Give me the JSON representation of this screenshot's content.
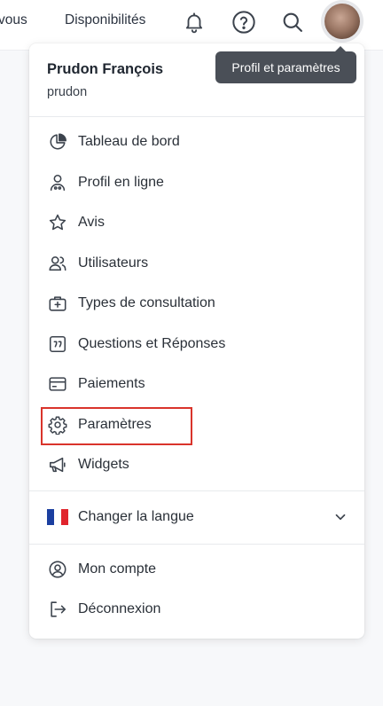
{
  "topbar": {
    "nav_partial": "vous",
    "nav_disponibilites": "Disponibilités"
  },
  "tooltip": {
    "text": "Profil et paramètres"
  },
  "user": {
    "name": "Prudon François",
    "username": "prudon"
  },
  "menu": {
    "items": [
      {
        "label": "Tableau de bord",
        "icon": "pie-chart-icon"
      },
      {
        "label": "Profil en ligne",
        "icon": "profile-icon"
      },
      {
        "label": "Avis",
        "icon": "star-icon"
      },
      {
        "label": "Utilisateurs",
        "icon": "users-icon"
      },
      {
        "label": "Types de consultation",
        "icon": "medical-kit-icon"
      },
      {
        "label": "Questions et Réponses",
        "icon": "quote-icon"
      },
      {
        "label": "Paiements",
        "icon": "credit-card-icon"
      },
      {
        "label": "Paramètres",
        "icon": "gear-icon"
      },
      {
        "label": "Widgets",
        "icon": "megaphone-icon"
      }
    ],
    "language": {
      "label": "Changer la langue",
      "icon": "france-flag-icon"
    },
    "account": [
      {
        "label": "Mon compte",
        "icon": "user-circle-icon"
      },
      {
        "label": "Déconnexion",
        "icon": "logout-icon"
      }
    ]
  },
  "colors": {
    "highlight_border": "#d9342b",
    "tooltip_bg": "#4a4f57",
    "icon_stroke": "#3c434d"
  }
}
